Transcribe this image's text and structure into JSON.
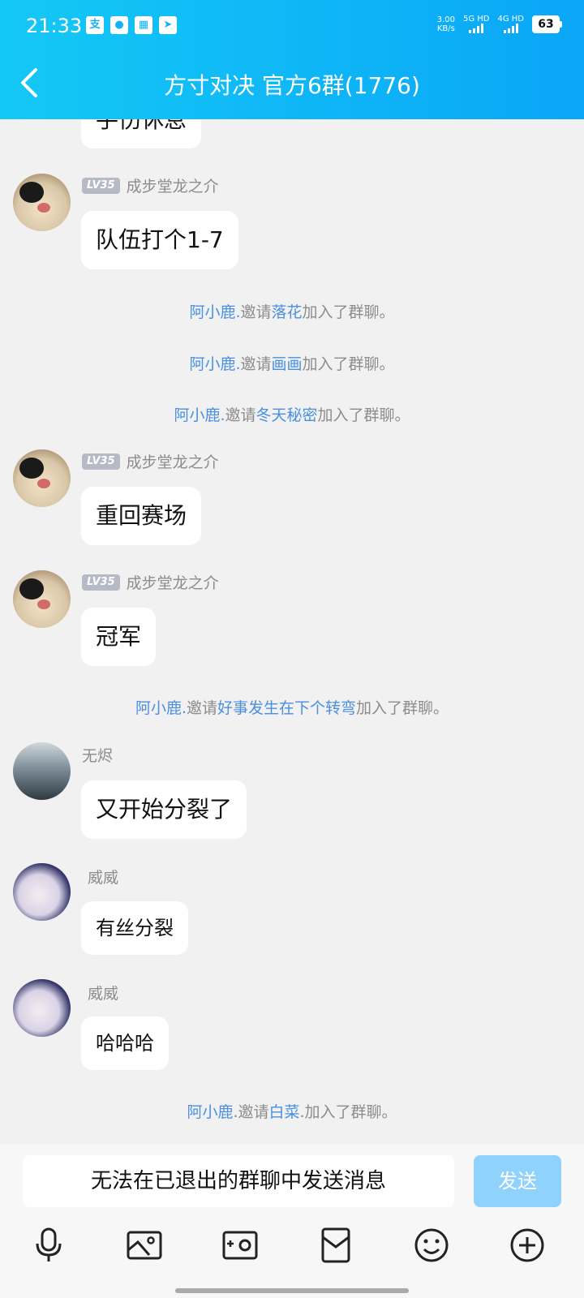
{
  "status_bar": {
    "time": "21:33",
    "net_speed_value": "3.00",
    "net_speed_unit": "KB/s",
    "sig1_label": "5G HD",
    "sig2_label": "4G HD",
    "battery": "63",
    "left_icons": [
      "alipay-icon",
      "app-icon",
      "image-icon",
      "telegram-icon"
    ]
  },
  "header": {
    "title": "方寸对决 官方6群(1776)"
  },
  "messages": {
    "m0": {
      "text": "手伤休息"
    },
    "m1": {
      "level": "LV35",
      "sender": "成步堂龙之介",
      "text": "队伍打个1-7"
    },
    "s1": {
      "inviter": "阿小鹿.",
      "action": "邀请",
      "invitee": "落花",
      "suffix": "加入了群聊。"
    },
    "s2": {
      "inviter": "阿小鹿.",
      "action": "邀请",
      "invitee": "画画",
      "suffix": "加入了群聊。"
    },
    "s3": {
      "inviter": "阿小鹿.",
      "action": "邀请",
      "invitee": "冬天秘密",
      "suffix": "加入了群聊。"
    },
    "m2": {
      "level": "LV35",
      "sender": "成步堂龙之介",
      "text": "重回赛场"
    },
    "m3": {
      "level": "LV35",
      "sender": "成步堂龙之介",
      "text": "冠军"
    },
    "s4": {
      "inviter": "阿小鹿.",
      "action": "邀请",
      "invitee": "好事发生在下个转弯",
      "suffix": "加入了群聊。"
    },
    "m4": {
      "sender": "无烬",
      "text": "又开始分裂了"
    },
    "m5": {
      "sender": "威威",
      "text": "有丝分裂"
    },
    "m6": {
      "sender": "威威",
      "text": "哈哈哈"
    },
    "s5": {
      "inviter": "阿小鹿.",
      "action": "邀请",
      "invitee": "白菜.",
      "suffix": "加入了群聊。"
    }
  },
  "input": {
    "notice": "无法在已退出的群聊中发送消息",
    "send_label": "发送"
  },
  "toolbar": {
    "tools": [
      "microphone-icon",
      "image-icon",
      "camera-icon",
      "red-packet-icon",
      "emoji-icon",
      "plus-icon"
    ]
  },
  "colors": {
    "header_start": "#14c8f5",
    "header_end": "#0aa6f7",
    "link": "#4a8fe0",
    "send_disabled": "#8fd2fb"
  }
}
